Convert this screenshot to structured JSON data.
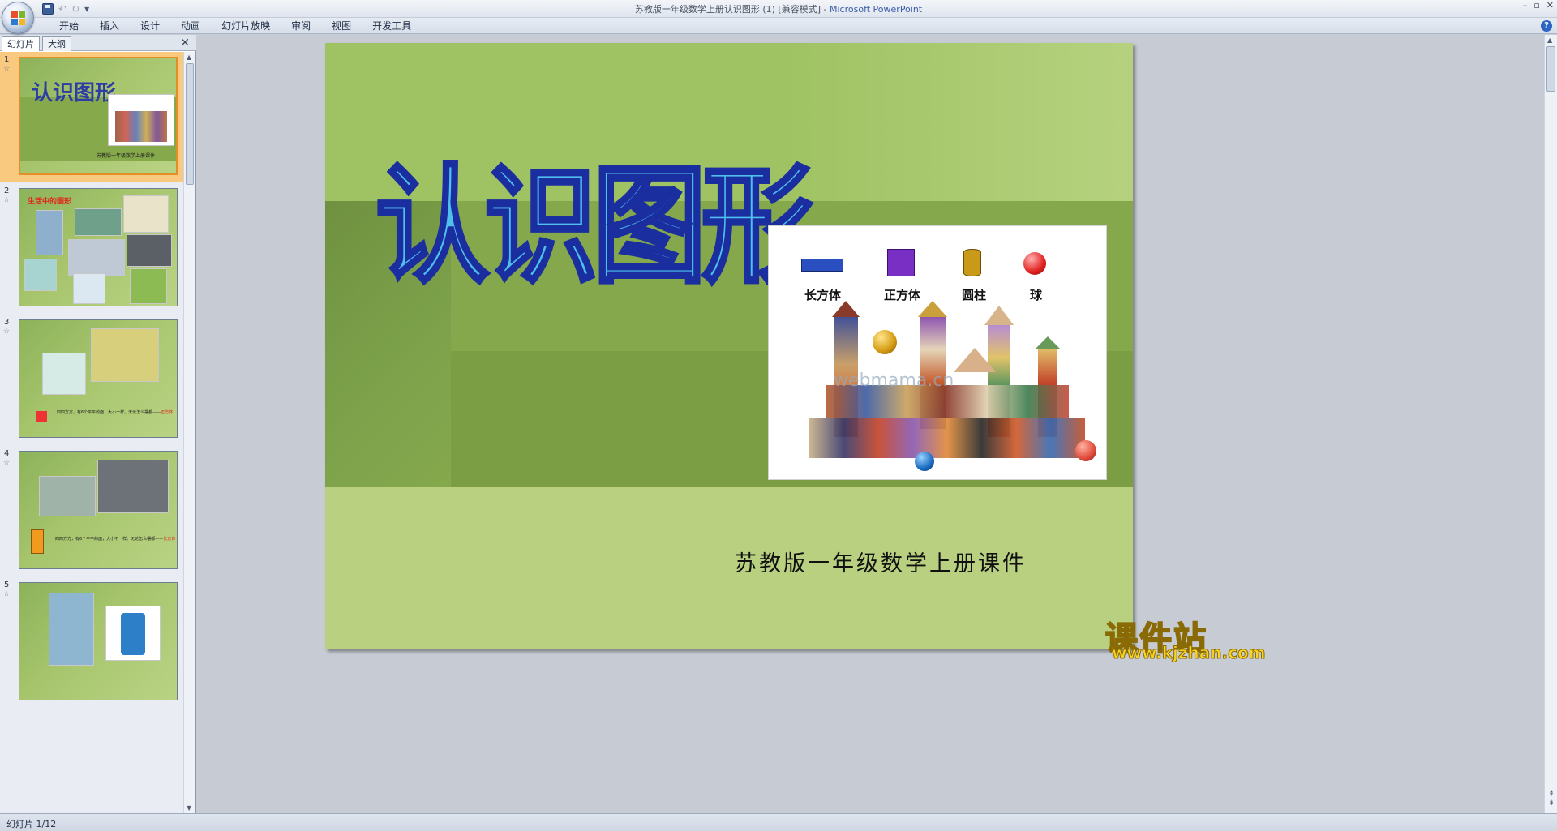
{
  "window": {
    "title": "苏教版一年级数学上册认识图形 (1) [兼容模式]",
    "separator": " - ",
    "app": "Microsoft PowerPoint",
    "controls": [
      "–",
      "▫",
      "✕"
    ]
  },
  "qat": {
    "undo": "↶",
    "redo": "↻",
    "customize": "▾"
  },
  "ribbon": {
    "tabs": [
      "开始",
      "插入",
      "设计",
      "动画",
      "幻灯片放映",
      "审阅",
      "视图",
      "开发工具"
    ],
    "help": "?"
  },
  "leftpane": {
    "tabs": [
      "幻灯片",
      "大纲"
    ],
    "close": "✕",
    "thumbs": [
      {
        "num": "1",
        "title": "认识图形",
        "subtitle": "苏教版一年级数学上册课件"
      },
      {
        "num": "2",
        "title": "生活中的图形"
      },
      {
        "num": "3",
        "text": "四四方方，有6个平平的面，大小一样。无论怎么摆都——",
        "highlight": "正方体"
      },
      {
        "num": "4",
        "text": "四四方方，有6个平平的面，大小不一样。无论怎么摆都——",
        "highlight": "长方体"
      },
      {
        "num": "5"
      }
    ]
  },
  "slide": {
    "title": "认识图形",
    "subtitle": "苏教版一年级数学上册课件",
    "image": {
      "labels": [
        "长方体",
        "正方体",
        "圆柱",
        "球"
      ],
      "watermark": "webmama.cn"
    }
  },
  "brand": {
    "name": "课件站",
    "url": "www.kjzhan.com"
  },
  "status": {
    "slide_indicator": "幻灯片 1/12"
  },
  "colors": {
    "slide_green": "#9fc262",
    "title_fill": "#4fc0ee",
    "title_stroke": "#1a2ea0",
    "selected_thumb": "#f8c97f",
    "brand_yellow": "#f7d424"
  }
}
